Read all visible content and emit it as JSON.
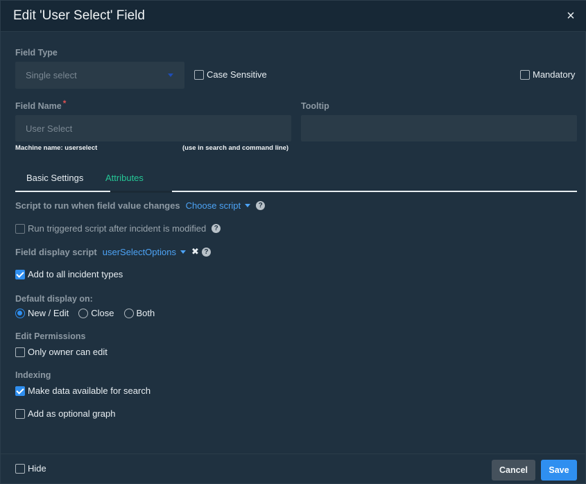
{
  "dialog": {
    "title": "Edit 'User Select' Field",
    "close_symbol": "×"
  },
  "field_type": {
    "label": "Field Type",
    "value": "Single select"
  },
  "case_sensitive": {
    "label": "Case Sensitive",
    "checked": false
  },
  "mandatory": {
    "label": "Mandatory",
    "checked": false
  },
  "field_name": {
    "label": "Field Name",
    "required_mark": "*",
    "placeholder": "User Select",
    "machine_name": "Machine name: userselect",
    "hint": "(use in search and command line)"
  },
  "tooltip": {
    "label": "Tooltip",
    "value": ""
  },
  "tabs": [
    {
      "label": "Basic Settings",
      "active": false
    },
    {
      "label": "Attributes",
      "active": true
    }
  ],
  "attributes": {
    "script_change_label": "Script to run when field value changes",
    "script_change_value": "Choose script",
    "run_triggered_label": "Run triggered script after incident is modified",
    "display_script_label": "Field display script",
    "display_script_value": "userSelectOptions",
    "add_all_types_label": "Add to all incident types",
    "default_display_label": "Default display on:",
    "display_options": [
      "New / Edit",
      "Close",
      "Both"
    ],
    "edit_permissions_label": "Edit Permissions",
    "only_owner_label": "Only owner can edit",
    "indexing_label": "Indexing",
    "make_search_label": "Make data available for search",
    "optional_graph_label": "Add as optional graph",
    "help_symbol": "?",
    "clear_symbol": "✖"
  },
  "footer": {
    "hide_label": "Hide",
    "cancel_label": "Cancel",
    "save_label": "Save"
  },
  "colors": {
    "accent": "#2f8ff0",
    "active_tab": "#25c796",
    "link": "#4da3f5",
    "background": "#1f3140"
  }
}
